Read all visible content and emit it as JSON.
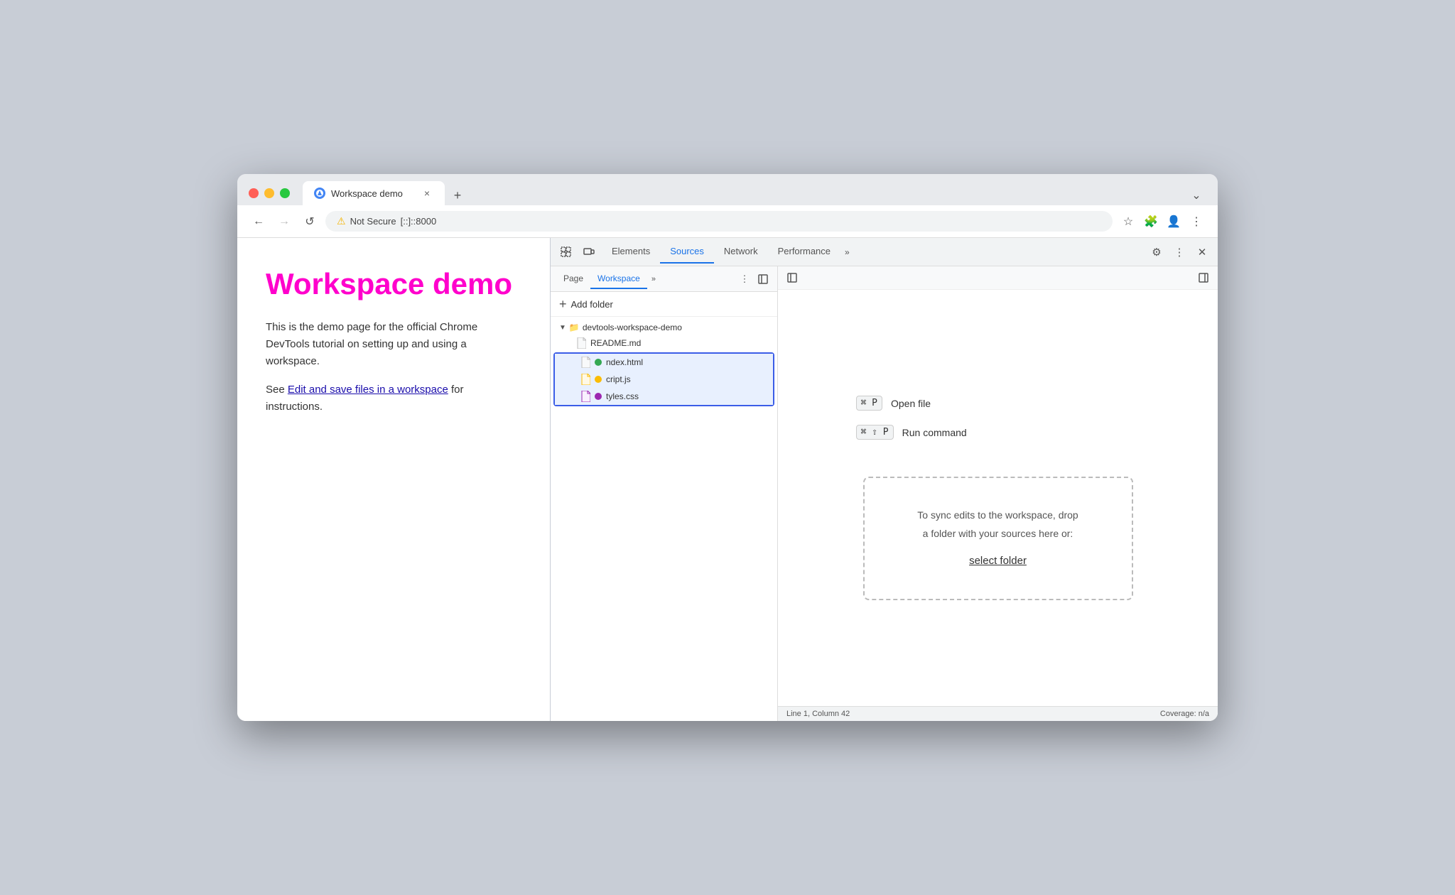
{
  "browser": {
    "tab_title": "Workspace demo",
    "tab_close": "×",
    "new_tab": "+",
    "address_warning": "⚠",
    "address_not_secure": "Not Secure",
    "address_url": "[::]::8000",
    "nav_back": "←",
    "nav_forward": "→",
    "nav_refresh": "↺",
    "more_tabs_icon": "⌄"
  },
  "page": {
    "title": "Workspace demo",
    "body_text": "This is the demo page for the official Chrome DevTools tutorial on setting up and using a workspace.",
    "see_label": "See ",
    "link_text": "Edit and save files in a workspace",
    "link_suffix": " for instructions."
  },
  "devtools": {
    "tabs": [
      {
        "label": "Elements",
        "active": false
      },
      {
        "label": "Sources",
        "active": true
      },
      {
        "label": "Network",
        "active": false
      },
      {
        "label": "Performance",
        "active": false
      }
    ],
    "tab_overflow": "»",
    "sources": {
      "left_tabs": [
        {
          "label": "Page",
          "active": false
        },
        {
          "label": "Workspace",
          "active": true
        }
      ],
      "tab_overflow": "»",
      "add_folder_label": "Add folder",
      "folder_name": "devtools-workspace-demo",
      "files": [
        {
          "name": "README.md",
          "type": "doc",
          "dot": null,
          "highlighted": false
        },
        {
          "name": "ndex.html",
          "type": "html",
          "dot": "green",
          "highlighted": true
        },
        {
          "name": "cript.js",
          "type": "js",
          "dot": "orange",
          "highlighted": true
        },
        {
          "name": "tyles.css",
          "type": "css",
          "dot": "purple",
          "highlighted": true
        }
      ],
      "shortcuts": [
        {
          "keys": "⌘ P",
          "label": "Open file"
        },
        {
          "keys": "⌘ ⇧ P",
          "label": "Run command"
        }
      ],
      "drop_zone_line1": "To sync edits to the workspace, drop",
      "drop_zone_line2": "a folder with your sources here or:",
      "select_folder_label": "select folder",
      "status_left": "Line 1, Column 42",
      "status_right": "Coverage: n/a"
    }
  }
}
